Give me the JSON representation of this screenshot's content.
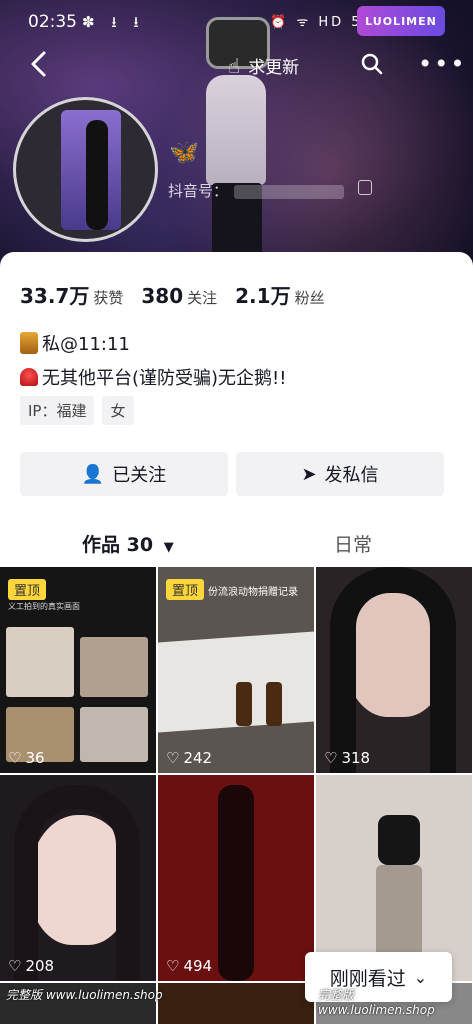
{
  "status_bar": {
    "time": "02:35",
    "left_icons": "✽ ⭳ ⭳",
    "right_icons": "⏰ ᯤ HD 5G"
  },
  "watermark_top": "LUOLIMEN",
  "nav": {
    "request_update": "求更新"
  },
  "profile": {
    "douyin_id_label": "抖音号：",
    "stats": [
      {
        "value": "33.7万",
        "label": "获赞"
      },
      {
        "value": "380",
        "label": "关注"
      },
      {
        "value": "2.1万",
        "label": "粉丝"
      }
    ],
    "bio_line1": "私@11:11",
    "bio_line2": "无其他平台(谨防受骗)无企鹅!!",
    "tags": [
      "IP：福建",
      "女"
    ],
    "follow_button": "已关注",
    "message_button": "发私信"
  },
  "tabs": {
    "works": "作品 30",
    "daily": "日常"
  },
  "grid": [
    {
      "likes": "36",
      "pinned": true,
      "pin_label": "置顶",
      "caption": "义工拍到的真实画面"
    },
    {
      "likes": "242",
      "pinned": true,
      "pin_label": "置顶",
      "caption": "份流浪动物捐赠记录"
    },
    {
      "likes": "318",
      "pinned": false
    },
    {
      "likes": "208",
      "pinned": false
    },
    {
      "likes": "494",
      "pinned": false
    },
    {
      "likes": "",
      "pinned": false
    }
  ],
  "float_button": "刚刚看过",
  "watermarks_bottom": [
    "完整版 www.luolimen.shop",
    "完整版 www.luolimen.shop"
  ],
  "colors": {
    "accent": "#fe2c55",
    "pin": "#fdd63b",
    "bg": "#ffffff"
  }
}
